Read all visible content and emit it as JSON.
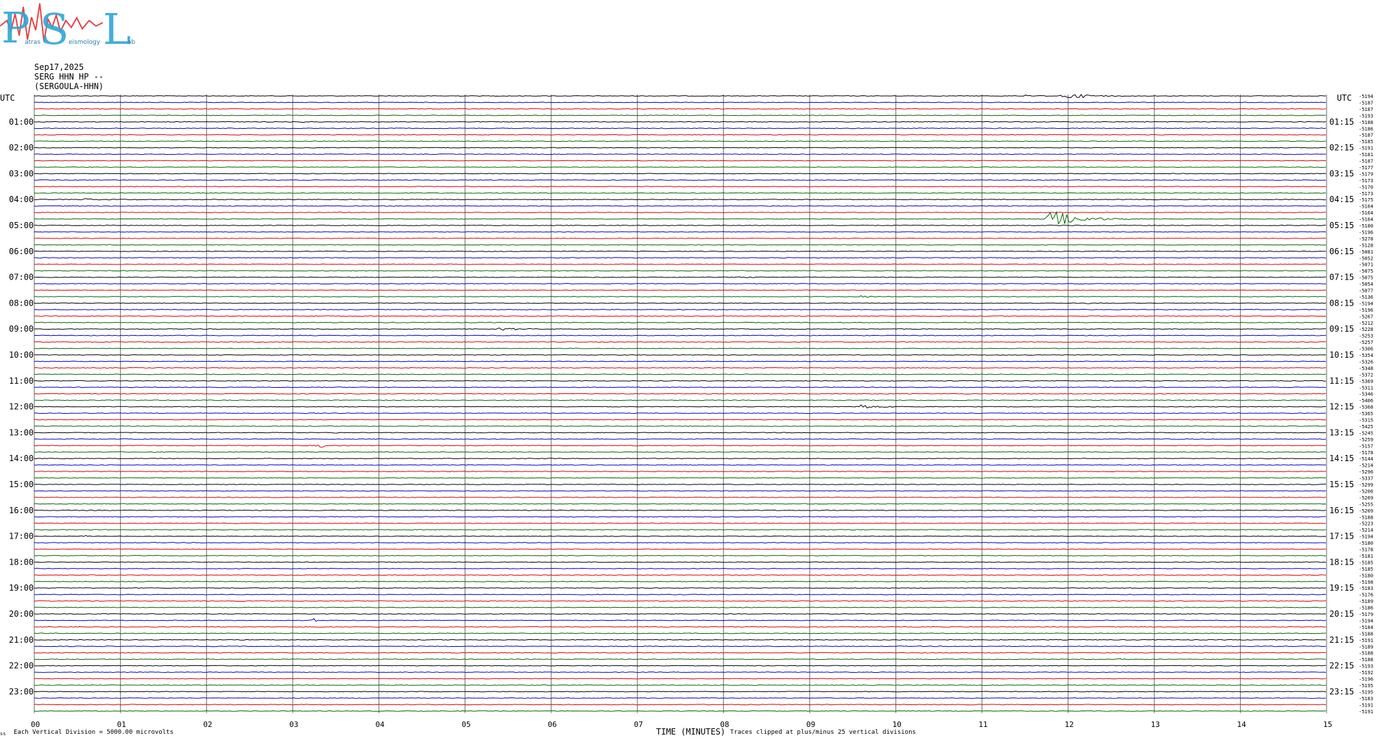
{
  "logo": {
    "letters": [
      "P",
      "S",
      "L"
    ],
    "small_words": [
      "atras",
      "eismology",
      "ab"
    ]
  },
  "header": {
    "date": "Sep17,2025",
    "station": "SERG HHN HP --",
    "site": "(SERGOULA-HHN)"
  },
  "left_unit": "UTC",
  "right_unit": "UTC",
  "footer": {
    "corner": "ss",
    "scale_note": "Each Vertical Division = 5000.00 microvolts",
    "xlabel": "TIME (MINUTES)",
    "clip_note": "Traces clipped at plus/minus 25 vertical divisions"
  },
  "colors": {
    "black": "#000000",
    "blue": "#0000cc",
    "red": "#dd0000",
    "green": "#006600",
    "grid": "#888888"
  },
  "chart_data": {
    "type": "line",
    "title": "",
    "xlabel": "TIME (MINUTES)",
    "ylabel": "",
    "xlim": [
      0,
      15
    ],
    "x_ticks": [
      "00",
      "01",
      "02",
      "03",
      "04",
      "05",
      "06",
      "07",
      "08",
      "09",
      "10",
      "11",
      "12",
      "13",
      "14",
      "15"
    ],
    "trace_count": 96,
    "trace_minutes": 15,
    "trace_color_cycle": [
      "black",
      "blue",
      "red",
      "green"
    ],
    "left_hour_labels": [
      "01:00",
      "02:00",
      "03:00",
      "04:00",
      "05:00",
      "06:00",
      "07:00",
      "08:00",
      "09:00",
      "10:00",
      "11:00",
      "12:00",
      "13:00",
      "14:00",
      "15:00",
      "16:00",
      "17:00",
      "18:00",
      "19:00",
      "20:00",
      "21:00",
      "22:00",
      "23:00"
    ],
    "right_hour_labels": [
      "01:15",
      "02:15",
      "03:15",
      "04:15",
      "05:15",
      "06:15",
      "07:15",
      "08:15",
      "09:15",
      "10:15",
      "11:15",
      "12:15",
      "13:15",
      "14:15",
      "15:15",
      "16:15",
      "17:15",
      "18:15",
      "19:15",
      "20:15",
      "21:15",
      "22:15",
      "23:15"
    ],
    "offset_labels": [
      "-5194",
      "-5187",
      "-5187",
      "-5193",
      "-5188",
      "-5186",
      "-5187",
      "-5185",
      "-5191",
      "-5181",
      "-5187",
      "-5177",
      "-5179",
      "-5173",
      "-5170",
      "-5173",
      "-5175",
      "-5164",
      "-5164",
      "-5164",
      "-5180",
      "-5196",
      "-5278",
      "-5128",
      "-5081",
      "-5052",
      "-5071",
      "-5075",
      "-5075",
      "-5054",
      "-5077",
      "-5136",
      "-5194",
      "-5196",
      "-5267",
      "-5212",
      "-5228",
      "-5253",
      "-5257",
      "-5306",
      "-5354",
      "-5326",
      "-5348",
      "-5372",
      "-5369",
      "-5311",
      "-5346",
      "-5406",
      "-5368",
      "-5365",
      "-5315",
      "-5425",
      "-5245",
      "-5259",
      "-5157",
      "-5178",
      "-5144",
      "-5214",
      "-5296",
      "-5337",
      "-5299",
      "-5206",
      "-5269",
      "-5255",
      "-5209",
      "-5188",
      "-5223",
      "-5214",
      "-5194",
      "-5180",
      "-5178",
      "-5181",
      "-5185",
      "-5185",
      "-5180",
      "-5198",
      "-5183",
      "-5176",
      "-5189",
      "-5186",
      "-5179",
      "-5194",
      "-5184",
      "-5188",
      "-5191",
      "-5189",
      "-5188",
      "-5188",
      "-5193",
      "-5192",
      "-5196",
      "-5195",
      "-5195",
      "-5183",
      "-5191",
      "-5191"
    ],
    "events": [
      {
        "trace": 0,
        "minute": 11.97,
        "width": 0.45,
        "amp": 5.5
      },
      {
        "trace": 0,
        "minute": 11.5,
        "width": 0.3,
        "amp": 1.2
      },
      {
        "trace": 4,
        "minute": 3.1,
        "width": 0.2,
        "amp": 0.8
      },
      {
        "trace": 4,
        "minute": 12.9,
        "width": 0.2,
        "amp": 0.8
      },
      {
        "trace": 16,
        "minute": 0.6,
        "width": 0.5,
        "amp": 1.3
      },
      {
        "trace": 18,
        "minute": 3.5,
        "width": 0.4,
        "amp": 1.0
      },
      {
        "trace": 19,
        "minute": 11.8,
        "width": 0.6,
        "amp": 13.0
      },
      {
        "trace": 21,
        "minute": 12.9,
        "width": 0.2,
        "amp": 1.0
      },
      {
        "trace": 24,
        "minute": 2.8,
        "width": 0.2,
        "amp": 1.0
      },
      {
        "trace": 28,
        "minute": 8.1,
        "width": 0.4,
        "amp": 1.0
      },
      {
        "trace": 31,
        "minute": 9.6,
        "width": 0.3,
        "amp": 1.6
      },
      {
        "trace": 32,
        "minute": 12.2,
        "width": 0.5,
        "amp": 0.9
      },
      {
        "trace": 36,
        "minute": 5.4,
        "width": 0.5,
        "amp": 2.0
      },
      {
        "trace": 48,
        "minute": 9.6,
        "width": 0.45,
        "amp": 3.0
      },
      {
        "trace": 49,
        "minute": 3.2,
        "width": 0.2,
        "amp": 1.5
      },
      {
        "trace": 54,
        "minute": 3.3,
        "width": 0.08,
        "amp": 7.5
      },
      {
        "trace": 52,
        "minute": 3.5,
        "width": 0.2,
        "amp": 0.8
      },
      {
        "trace": 64,
        "minute": 12.7,
        "width": 0.3,
        "amp": 1.5
      },
      {
        "trace": 68,
        "minute": 0.6,
        "width": 0.3,
        "amp": 1.0
      },
      {
        "trace": 70,
        "minute": 13.3,
        "width": 0.3,
        "amp": 1.0
      },
      {
        "trace": 81,
        "minute": 3.25,
        "width": 0.06,
        "amp": 4.0
      },
      {
        "trace": 80,
        "minute": 0.5,
        "width": 0.05,
        "amp": 1.5
      },
      {
        "trace": 87,
        "minute": 12.6,
        "width": 0.4,
        "amp": 0.9
      }
    ]
  }
}
